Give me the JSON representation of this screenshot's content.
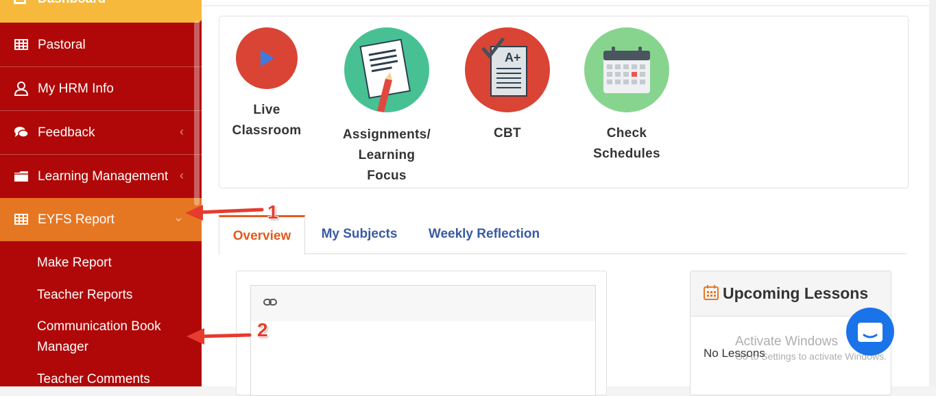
{
  "sidebar": {
    "dashboard_label": "Dashboard",
    "items": [
      {
        "label": "Pastoral",
        "icon": "table-icon"
      },
      {
        "label": "My HRM Info",
        "icon": "user-icon"
      },
      {
        "label": "Feedback",
        "icon": "comments-icon",
        "chevron": "‹"
      },
      {
        "label": "Learning Management",
        "icon": "folder-icon",
        "chevron": "‹"
      },
      {
        "label": "EYFS Report",
        "icon": "table-icon",
        "chevron": "⌄"
      }
    ],
    "submenu": [
      "Make Report",
      "Teacher Reports",
      "Communication Book Manager",
      "Teacher Comments"
    ]
  },
  "quick_links": [
    {
      "label_lines": [
        "Live",
        "Classroom"
      ],
      "icon": "play-icon",
      "color": "#d94435"
    },
    {
      "label_lines": [
        "Assignments/",
        "Learning",
        "Focus"
      ],
      "icon": "assignment-icon",
      "color": "#47c194"
    },
    {
      "label_lines": [
        "CBT"
      ],
      "icon": "test-paper-icon",
      "color": "#d94435"
    },
    {
      "label_lines": [
        "Check",
        "Schedules"
      ],
      "icon": "calendar-icon",
      "color": "#87d48e"
    }
  ],
  "tabs": [
    {
      "label": "Overview",
      "active": true
    },
    {
      "label": "My Subjects",
      "active": false
    },
    {
      "label": "Weekly Reflection",
      "active": false
    }
  ],
  "upcoming": {
    "title": "Upcoming Lessons",
    "empty_text": "No Lessons"
  },
  "watermark": {
    "line1": "Activate Windows",
    "line2": "Go to Settings to activate Windows."
  },
  "annotations": {
    "marker1": "1",
    "marker2": "2"
  },
  "colors": {
    "sidebar_bg": "#b00808",
    "active_item": "#e67722",
    "dashboard_bg": "#f6b93b",
    "tab_active": "#e35a1c",
    "tab_inactive": "#3a5aa3",
    "annotation_red": "#e63b2e"
  }
}
